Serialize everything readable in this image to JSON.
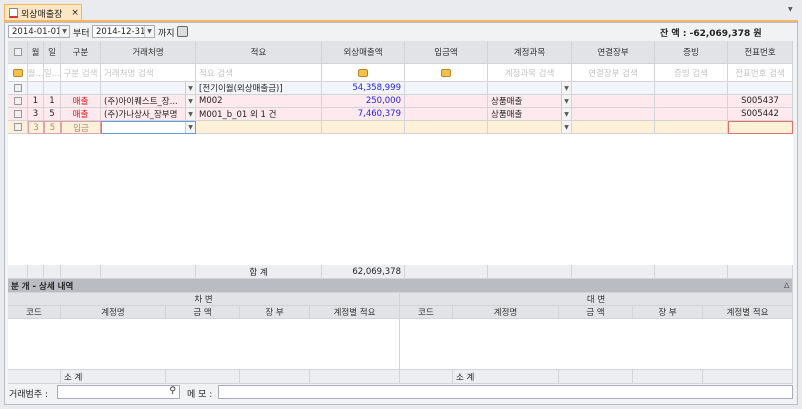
{
  "tab": {
    "title": "외상매출장",
    "close": "×"
  },
  "filter": {
    "from": "2014-01-01",
    "from_suffix": "부터",
    "to": "2014-12-31",
    "to_suffix": "까지"
  },
  "balance": {
    "label": "잔 액 :",
    "value": "-62,069,378 원"
  },
  "grid": {
    "columns": [
      "",
      "월",
      "일",
      "구분",
      "거래처명",
      "적요",
      "외상매출액",
      "입금액",
      "계정과목",
      "연결장부",
      "증빙",
      "전표번호"
    ],
    "filters": [
      "",
      "월...",
      "일...",
      "구분 검색",
      "거래처명 검색",
      "적요 검색",
      "",
      "",
      "계정과목 검색",
      "연결장부 검색",
      "증빙 검색",
      "전표번호 검색"
    ],
    "rows": [
      {
        "month": "",
        "day": "",
        "type": "",
        "client": "",
        "memo": "[전기이월(외상매출금)]",
        "sales": "54,358,999",
        "deposit": "",
        "account": "",
        "ledger": "",
        "evidence": "",
        "voucher": ""
      },
      {
        "month": "1",
        "day": "1",
        "type": "매출",
        "client": "(주)아이퀘스트_장...",
        "memo": "M002",
        "sales": "250,000",
        "deposit": "",
        "account": "상품매출",
        "ledger": "",
        "evidence": "",
        "voucher": "S005437"
      },
      {
        "month": "3",
        "day": "5",
        "type": "매출",
        "client": "(주)가나상사_장부명",
        "memo": "M001_b_01 외 1 건",
        "sales": "7,460,379",
        "deposit": "",
        "account": "상품매출",
        "ledger": "",
        "evidence": "",
        "voucher": "S005442"
      },
      {
        "month": "3",
        "day": "5",
        "type": "입금",
        "client": "",
        "memo": "",
        "sales": "",
        "deposit": "",
        "account": "",
        "ledger": "",
        "evidence": "",
        "voucher": ""
      }
    ],
    "total_label": "합 계",
    "total_sales": "62,069,378"
  },
  "detail": {
    "title": "분 개 - 상세 내역",
    "debit": "차 변",
    "credit": "대 변",
    "columns": [
      "코드",
      "계정명",
      "금 액",
      "장 부",
      "계정별 적요"
    ],
    "subtotal": "소 계"
  },
  "bottom": {
    "client_label": "거래범주 :",
    "memo_label": "메 모 :",
    "client_value": "",
    "memo_value": ""
  }
}
